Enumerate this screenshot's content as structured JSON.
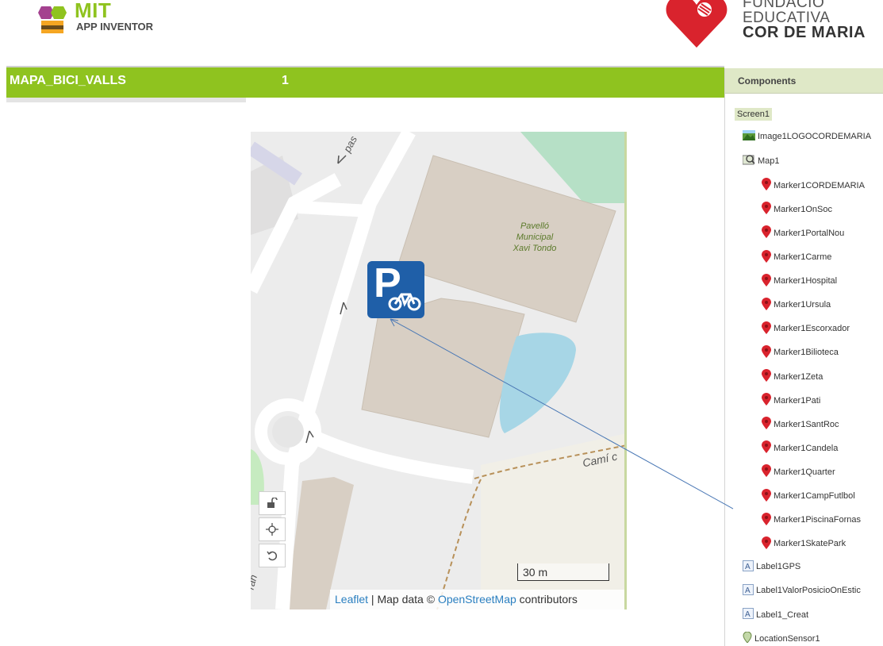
{
  "header": {
    "app_logo": {
      "title": "MIT",
      "subtitle": "APP INVENTOR"
    },
    "sponsor": {
      "line1": "FUNDACIÓ",
      "line2": "EDUCATIVA",
      "line3": "COR DE MARIA"
    }
  },
  "project_bar": {
    "project_name": "MAPA_BICI_VALLS",
    "screen_number": "1"
  },
  "map": {
    "place_label": "Pavelló Municipal Xavi Tondo",
    "place_line1": "Pavelló",
    "place_line2": "Municipal",
    "place_line3": "Xavi Tondo",
    "street_1": "pas",
    "street_2": "Camí c",
    "street_3": "ran",
    "parking_letter": "P",
    "scale": "30 m",
    "attribution": {
      "leaflet": "Leaflet",
      "sep": " | Map data © ",
      "osm": "OpenStreetMap",
      "tail": " contributors"
    },
    "controls": [
      "lock-icon",
      "locate-icon",
      "reset-view-icon"
    ]
  },
  "components": {
    "header": "Components",
    "screen": "Screen1",
    "items": [
      {
        "label": "Image1LOGOCORDEMARIA",
        "icon": "image-icon",
        "level": 1
      },
      {
        "label": "Map1",
        "icon": "map-icon",
        "level": 1
      },
      {
        "label": "Marker1CORDEMARIA",
        "icon": "marker-icon",
        "level": 2
      },
      {
        "label": "Marker1OnSoc",
        "icon": "marker-icon",
        "level": 2
      },
      {
        "label": "Marker1PortalNou",
        "icon": "marker-icon",
        "level": 2
      },
      {
        "label": "Marker1Carme",
        "icon": "marker-icon",
        "level": 2
      },
      {
        "label": "Marker1Hospital",
        "icon": "marker-icon",
        "level": 2
      },
      {
        "label": "Marker1Ursula",
        "icon": "marker-icon",
        "level": 2
      },
      {
        "label": "Marker1Escorxador",
        "icon": "marker-icon",
        "level": 2
      },
      {
        "label": "Marker1Bilioteca",
        "icon": "marker-icon",
        "level": 2
      },
      {
        "label": "Marker1Zeta",
        "icon": "marker-icon",
        "level": 2
      },
      {
        "label": "Marker1Pati",
        "icon": "marker-icon",
        "level": 2
      },
      {
        "label": "Marker1SantRoc",
        "icon": "marker-icon",
        "level": 2
      },
      {
        "label": "Marker1Candela",
        "icon": "marker-icon",
        "level": 2
      },
      {
        "label": "Marker1Quarter",
        "icon": "marker-icon",
        "level": 2
      },
      {
        "label": "Marker1CampFutlbol",
        "icon": "marker-icon",
        "level": 2
      },
      {
        "label": "Marker1PiscinaFornas",
        "icon": "marker-icon",
        "level": 2
      },
      {
        "label": "Marker1SkatePark",
        "icon": "marker-icon",
        "level": 2
      },
      {
        "label": "Label1GPS",
        "icon": "label-icon",
        "level": 1
      },
      {
        "label": "Label1ValorPosicioOnEstic",
        "icon": "label-icon",
        "level": 1
      },
      {
        "label": "Label1_Creat",
        "icon": "label-icon",
        "level": 1
      },
      {
        "label": "LocationSensor1",
        "icon": "location-sensor-icon",
        "level": 1
      }
    ]
  },
  "colors": {
    "brand_green": "#8fc31f",
    "marker_red": "#d9232d",
    "parking_blue": "#1f5fa8",
    "link_blue": "#2a7fc0"
  }
}
